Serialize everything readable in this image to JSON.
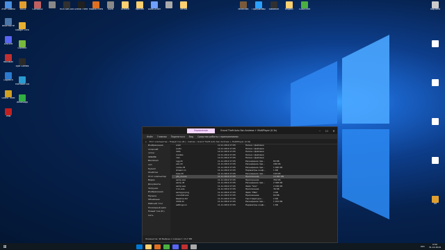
{
  "desktop": {
    "top_icons": [
      {
        "label": "Этот компьютер",
        "color": "#4a8fe0"
      },
      {
        "label": "AOLA",
        "color": "#e0a030"
      },
      {
        "label": "Combo02",
        "color": "#c06060"
      },
      {
        "label": "",
        "color": "#888888"
      },
      {
        "label": "MTA San Andreas",
        "color": "#303030"
      },
      {
        "label": "Grand Theft Auto V",
        "color": "#202020"
      },
      {
        "label": "Mozilla Firefox",
        "color": "#e07020"
      },
      {
        "label": "Aura",
        "color": "#888888"
      },
      {
        "label": "SERVER",
        "color": "#ffd070"
      },
      {
        "label": "прочее",
        "color": "#ffd070"
      },
      {
        "label": "AutoClicker",
        "color": "#70a0ff"
      },
      {
        "label": "",
        "color": "#aaaaaa"
      },
      {
        "label": "сетки",
        "color": "#ffd070"
      }
    ],
    "left_icons": [
      {
        "label": "ВКонтакте",
        "color": "#4a76a8"
      },
      {
        "label": "Google Chrome",
        "color": "#e8b030"
      },
      {
        "label": "Discord",
        "color": "#5865f2"
      },
      {
        "label": "uTorrent",
        "color": "#78b83c"
      },
      {
        "label": "Rockstar",
        "color": "#c03030"
      },
      {
        "label": "Epic Games",
        "color": "#2a2a2a"
      },
      {
        "label": "Logitech",
        "color": "#2a7ad0"
      },
      {
        "label": "Microsoft Edge",
        "color": "#2a9ad0"
      },
      {
        "label": "Grand Theft",
        "color": "#d0a020"
      },
      {
        "label": "WhatsApp",
        "color": "#30b040"
      },
      {
        "label": "lmw",
        "color": "#c02020"
      }
    ],
    "right_icons": [
      {
        "label": "Корзина",
        "color": "#cccccc"
      },
      {
        "label": "",
        "color": "#ffffff"
      },
      {
        "label": "",
        "color": "#ffffff"
      },
      {
        "label": "",
        "color": "#ffffff"
      },
      {
        "label": "",
        "color": "#ffffff"
      },
      {
        "label": "RH",
        "color": "#e0a030"
      }
    ],
    "top_right_icons": [
      {
        "label": "Minecraft",
        "color": "#7a5a3a"
      },
      {
        "label": "Программы",
        "color": "#2aa0ff"
      },
      {
        "label": "SteamVR",
        "color": "#303030"
      },
      {
        "label": "Яндекс",
        "color": "#ffd070"
      },
      {
        "label": "TLauncher",
        "color": "#4ab040"
      }
    ]
  },
  "explorer": {
    "manage_tab": "Управление",
    "title": "Grand Theft Auto San Andreas + MultiPlayer (0.3z)",
    "ribbon": [
      "Файл",
      "Главная",
      "Поделиться",
      "Вид",
      "Средства работы с приложениями"
    ],
    "address": "Этот компьютер › Новый том (D:) › Games › Grand Theft Auto San Andreas + MultiPlayer (0.3z)",
    "nav": [
      "Изображения",
      "minecraft",
      "сетки",
      "SERVER",
      "Bandicam",
      "кал",
      "Hyland",
      "OneDrive",
      "Этот компьютер",
      "Видео",
      "Документы",
      "Загрузки",
      "Изображения",
      "Музыка",
      "Объемные",
      "Рабочий стол",
      "Локальный диск",
      "Новый том (D:)",
      "Сеть"
    ],
    "files": [
      {
        "name": "anim",
        "date": "12.11.2019 17:05",
        "type": "Папка с файлами",
        "size": "",
        "selected": false
      },
      {
        "name": "audio",
        "date": "12.11.2019 17:05",
        "type": "Папка с файлами",
        "size": "",
        "selected": false
      },
      {
        "name": "data",
        "date": "12.11.2019 17:05",
        "type": "Папка с файлами",
        "size": "",
        "selected": false
      },
      {
        "name": "models",
        "date": "12.11.2019 17:05",
        "type": "Папка с файлами",
        "size": "",
        "selected": false
      },
      {
        "name": "cleo",
        "date": "12.11.2019 17:05",
        "type": "Папка с файлами",
        "size": "",
        "selected": false
      },
      {
        "name": "ogg.dll",
        "date": "11.11.2019 17:05",
        "type": "Расширение при...",
        "size": "84 КБ",
        "selected": false
      },
      {
        "name": "eax.dll",
        "date": "11.11.2019 17:05",
        "type": "Расширение при...",
        "size": "184 КБ",
        "selected": false
      },
      {
        "name": "vorbis.dll",
        "date": "11.11.2019 17:05",
        "type": "Расширение при...",
        "size": "1 040 КБ",
        "selected": false
      },
      {
        "name": "stream.ini",
        "date": "11.11.2019 17:05",
        "type": "Параметры конф...",
        "size": "1 КБ",
        "selected": false
      },
      {
        "name": "bass.dll",
        "date": "11.11.2019 17:05",
        "type": "Расширение при...",
        "size": "120 КБ",
        "selected": false
      },
      {
        "name": "gta_sa.exe",
        "date": "11.11.2019 17:05",
        "type": "Приложение",
        "size": "14 062 КБ",
        "selected": true
      },
      {
        "name": "samp.exe",
        "date": "11.11.2019 17:05",
        "type": "Приложение",
        "size": "352 КБ",
        "selected": false
      },
      {
        "name": "samp.dll",
        "date": "11.11.2019 17:05",
        "type": "Расширение при...",
        "size": "2 048 КБ",
        "selected": false
      },
      {
        "name": "samp.saa",
        "date": "11.11.2019 17:05",
        "type": "Файл \"SAA\"",
        "size": "2 436 КБ",
        "selected": false
      },
      {
        "name": "rcon.exe",
        "date": "11.11.2019 17:05",
        "type": "Приложение",
        "size": "36 КБ",
        "selected": false
      },
      {
        "name": "sampgui.png",
        "date": "11.11.2019 17:05",
        "type": "Файл \"PNG\"",
        "size": "4 КБ",
        "selected": false
      },
      {
        "name": "uninstall.exe",
        "date": "11.11.2019 17:05",
        "type": "Приложение",
        "size": "64 КБ",
        "selected": false
      },
      {
        "name": "Readme.txt",
        "date": "11.11.2019 17:05",
        "type": "Текстовый док...",
        "size": "2 КБ",
        "selected": false
      },
      {
        "name": "d3d9.dll",
        "date": "11.11.2019 17:05",
        "type": "Расширение при...",
        "size": "1 012 КБ",
        "selected": false
      },
      {
        "name": "settings.ini",
        "date": "11.11.2019 17:05",
        "type": "Параметры конф...",
        "size": "1 КБ",
        "selected": false
      }
    ],
    "status": "Элементов: 46   Выбран 1 элемент: 13,7 МБ"
  },
  "taskbar": {
    "items": [
      "#0078d4",
      "#ffd070",
      "#e07020",
      "#4ab040",
      "#5865f2",
      "#c03030",
      "#aaaaaa"
    ],
    "tray_lang": "РУС",
    "time": "0:50",
    "date": "31.12.2019"
  }
}
